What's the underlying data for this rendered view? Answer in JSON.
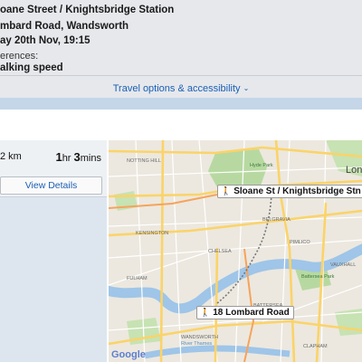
{
  "summary": {
    "from": "oane Street / Knightsbridge Station",
    "to": "mbard Road, Wandsworth",
    "when": "ay 20th Nov, 19:15",
    "preferences_label": "erences:",
    "speed": "alking speed"
  },
  "travel_options": {
    "label": "Travel options & accessibility",
    "chevron_icon": "chevron-down-icon"
  },
  "result": {
    "distance": "2 km",
    "duration_hr_value": "1",
    "duration_hr_unit": "hr",
    "duration_min_value": "3",
    "duration_min_unit": "mins",
    "view_details": "View Details"
  },
  "map": {
    "start_label": "Sloane St / Knightsbridge Stn",
    "end_label": "18 Lombard Road",
    "walk_icon": "walking-person-icon",
    "city_label": "Lon",
    "park_hyde": "Hyde Park",
    "park_battersea": "Battersea Park",
    "places": [
      "KENSINGTON",
      "CHELSEA",
      "BATTERSEA",
      "FULHAM",
      "WANDSWORTH",
      "PIMLICO",
      "VAUXHALL",
      "NOTTING HILL",
      "BELGRAVIA",
      "CLAPHAM"
    ],
    "river_name": "River Thames",
    "attribution": "Google"
  },
  "colors": {
    "summary_bg": "#e6e8ec",
    "link": "#1a5fb4",
    "strip": "#c4d6e8",
    "map_base": "#ece8df",
    "water": "#9fc5e8",
    "park": "#b7d9a1",
    "road_major": "#fbd368",
    "road_minor": "#ffffff"
  }
}
